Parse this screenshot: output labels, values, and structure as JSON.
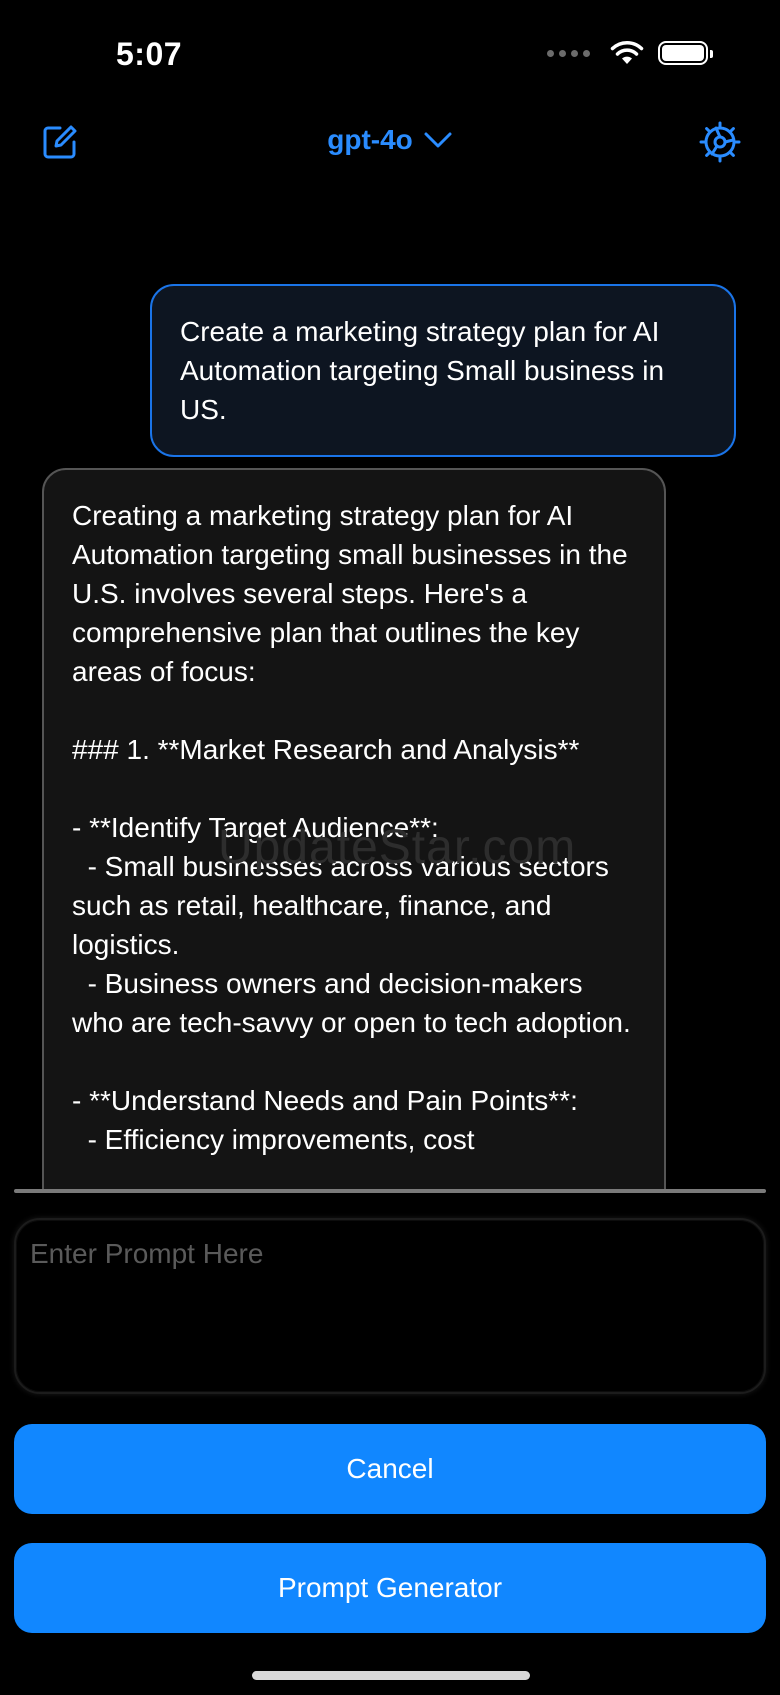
{
  "status_bar": {
    "time": "5:07"
  },
  "nav": {
    "model": "gpt-4o"
  },
  "colors": {
    "accent": "#1187ff",
    "link": "#2a8cff",
    "user_bubble_border": "#1a74e8"
  },
  "icons": {
    "compose": "compose-icon",
    "settings": "settings-icon",
    "chevron": "chevron-down-icon"
  },
  "chat": {
    "user_message": "Create a marketing strategy plan for AI Automation targeting Small business in US.",
    "assistant_message": "Creating a marketing strategy plan for AI Automation targeting small businesses in the U.S. involves several steps. Here's a comprehensive plan that outlines the key areas of focus:\n\n### 1. **Market Research and Analysis**\n\n- **Identify Target Audience**:\n  - Small businesses across various sectors such as retail, healthcare, finance, and logistics.\n  - Business owners and decision-makers who are tech-savvy or open to tech adoption.\n\n- **Understand Needs and Pain Points**:\n  - Efficiency improvements, cost",
    "watermark": "UpdateStar.com"
  },
  "input": {
    "placeholder": "Enter Prompt Here",
    "value": ""
  },
  "buttons": {
    "cancel": "Cancel",
    "prompt_generator": "Prompt Generator"
  }
}
